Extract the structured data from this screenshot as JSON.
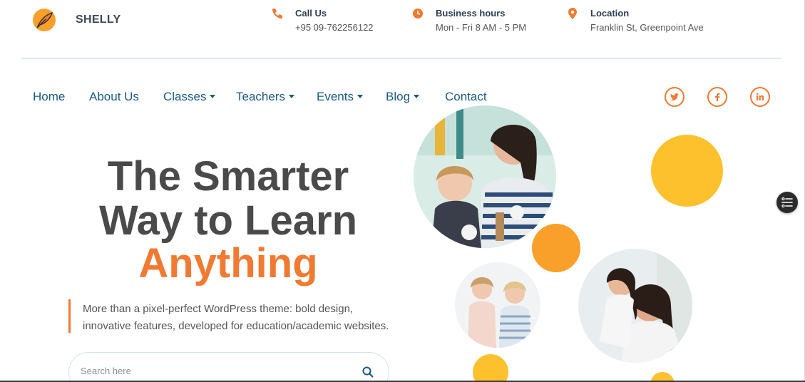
{
  "brand": {
    "name": "SHELLY",
    "logo_icon": "feather-logo-icon"
  },
  "contact": [
    {
      "label": "Call Us",
      "value": "+95 09-762256122",
      "icon": "phone-icon"
    },
    {
      "label": "Business hours",
      "value": "Mon - Fri 8 AM - 5 PM",
      "icon": "clock-icon"
    },
    {
      "label": "Location",
      "value": "Franklin St, Greenpoint Ave",
      "icon": "location-pin-icon"
    }
  ],
  "nav": {
    "items": [
      {
        "label": "Home",
        "has_dropdown": false
      },
      {
        "label": "About Us",
        "has_dropdown": false
      },
      {
        "label": "Classes",
        "has_dropdown": true
      },
      {
        "label": "Teachers",
        "has_dropdown": true
      },
      {
        "label": "Events",
        "has_dropdown": true
      },
      {
        "label": "Blog",
        "has_dropdown": true
      },
      {
        "label": "Contact",
        "has_dropdown": false
      }
    ]
  },
  "social": [
    {
      "name": "twitter",
      "icon": "twitter-icon"
    },
    {
      "name": "facebook",
      "icon": "facebook-icon"
    },
    {
      "name": "linkedin",
      "icon": "linkedin-icon"
    }
  ],
  "hero": {
    "title_line1": "The Smarter",
    "title_line2": "Way to Learn",
    "title_line3": "Anything",
    "subtitle_line1": "More than a pixel-perfect WordPress theme: bold design,",
    "subtitle_line2": "innovative features, developed for education/academic websites."
  },
  "search": {
    "placeholder": "Search here",
    "value": "",
    "icon": "search-icon"
  },
  "colors": {
    "accent_orange": "#f07a32",
    "nav_blue": "#1a5a86",
    "yellow_dot": "#fcc12d",
    "orange_dot": "#f9a02a",
    "heading_gray": "#4a4a4a"
  },
  "floating_button": {
    "icon": "toggle-list-icon"
  }
}
